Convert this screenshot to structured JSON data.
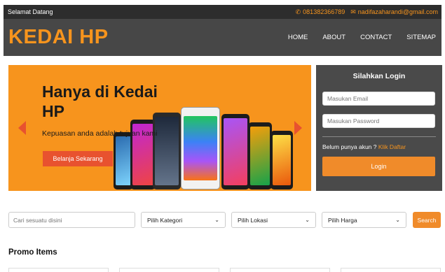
{
  "topbar": {
    "welcome": "Selamat Datang",
    "phone": "081382366789",
    "email": "nadifazaharandi@gmail.com"
  },
  "header": {
    "brand": "KEDAI HP",
    "nav": [
      "HOME",
      "ABOUT",
      "CONTACT",
      "SITEMAP"
    ]
  },
  "hero": {
    "title": "Hanya di Kedai HP",
    "subtitle": "Kepuasan anda adalah tujuan kami",
    "button": "Belanja Sekarang"
  },
  "login": {
    "title": "Silahkan Login",
    "email_placeholder": "Masukan Email",
    "password_placeholder": "Masukan Password",
    "register_text": "Belum punya akun ?",
    "register_link": "Klik Daftar",
    "button": "Login"
  },
  "search": {
    "placeholder": "Cari sesuatu disini",
    "category": "Pilih Kategori",
    "location": "Pilih Lokasi",
    "price": "Pilih Harga",
    "button": "Search"
  },
  "promo": {
    "title": "Promo Items"
  },
  "colors": {
    "accent": "#f7941d",
    "topbar": "#2d2d2d",
    "header": "#474747",
    "button_red": "#e8522f"
  }
}
